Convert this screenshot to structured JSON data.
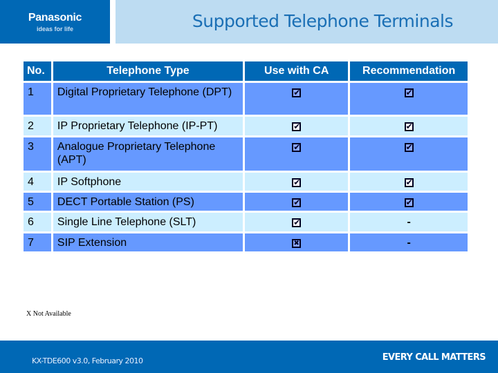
{
  "header": {
    "logo_name": "Panasonic",
    "logo_tagline": "ideas for life",
    "title": "Supported Telephone Terminals"
  },
  "table": {
    "columns": [
      "No.",
      "Telephone Type",
      "Use with CA",
      "Recommendation"
    ],
    "rows": [
      {
        "no": "1",
        "type": "Digital Proprietary Telephone (DPT)",
        "ca": "check",
        "rec": "check"
      },
      {
        "no": "2",
        "type": "IP Proprietary Telephone (IP-PT)",
        "ca": "check",
        "rec": "check"
      },
      {
        "no": "3",
        "type": "Analogue Proprietary Telephone (APT)",
        "ca": "check",
        "rec": "check"
      },
      {
        "no": "4",
        "type": "IP Softphone",
        "ca": "check",
        "rec": "check"
      },
      {
        "no": "5",
        "type": "DECT Portable Station (PS)",
        "ca": "check",
        "rec": "check"
      },
      {
        "no": "6",
        "type": "Single Line Telephone (SLT)",
        "ca": "check",
        "rec": "-"
      },
      {
        "no": "7",
        "type": "SIP Extension",
        "ca": "cross",
        "rec": "-"
      }
    ]
  },
  "icons": {
    "check": "checkbox-checked-icon",
    "cross": "checkbox-crossed-icon"
  },
  "note": "X Not Available",
  "footer": {
    "left": "KX-TDE600 v3.0, February 2010",
    "right": "EVERY CALL MATTERS"
  },
  "colors": {
    "brand_blue": "#0068b5",
    "title_bg": "#bddcf2",
    "title_text": "#1a6fb5",
    "row_dark": "#6699ff",
    "row_light": "#cceeff"
  }
}
